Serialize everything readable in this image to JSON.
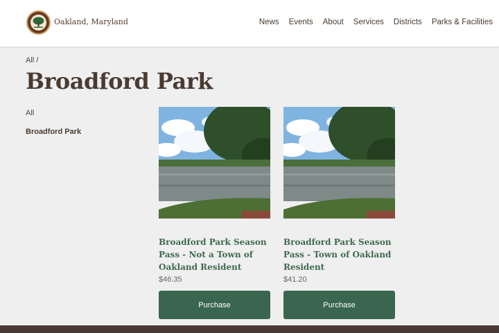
{
  "site": {
    "name": "Oakland, Maryland",
    "logo": "town-seal-tree-icon"
  },
  "nav": {
    "items": [
      "News",
      "Events",
      "About",
      "Services",
      "Districts",
      "Parks & Facilities"
    ]
  },
  "breadcrumb": {
    "root": "All",
    "separator": "/"
  },
  "page": {
    "title": "Broadford Park"
  },
  "sidebar": {
    "all_label": "All",
    "current_label": "Broadford Park"
  },
  "products": [
    {
      "name": "Broadford Park Season Pass - Not a Town of Oakland Resident",
      "price": "$46.35",
      "button": "Purchase"
    },
    {
      "name": "Broadford Park Season Pass - Town of Oakland Resident",
      "price": "$41.20",
      "button": "Purchase"
    }
  ],
  "colors": {
    "accent": "#3a6650",
    "heading": "#4a3b33",
    "product_title": "#3e6a4e",
    "footer": "#4b3a33"
  }
}
